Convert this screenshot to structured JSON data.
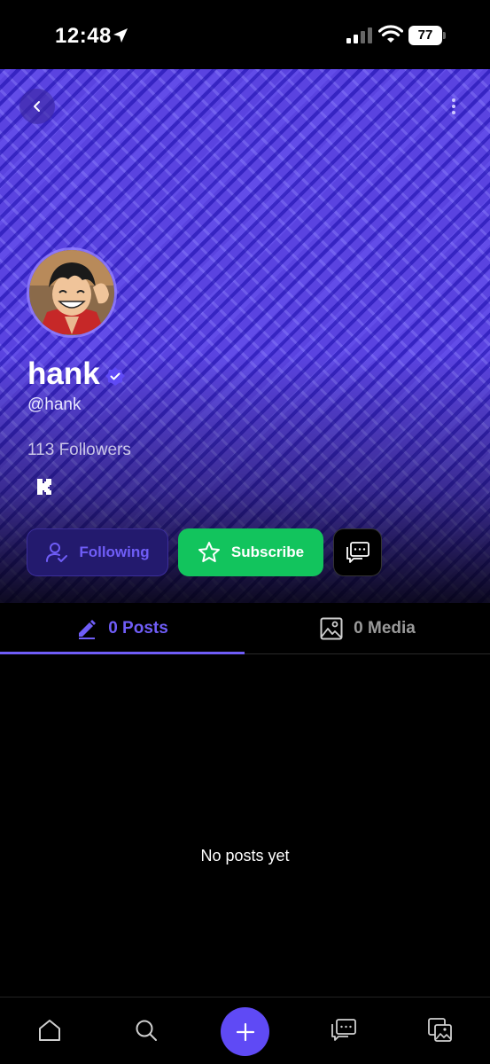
{
  "status_bar": {
    "time": "12:48",
    "battery": "77"
  },
  "profile": {
    "display_name": "hank",
    "username": "@hank",
    "followers": "113 Followers",
    "verified": true,
    "avatar": "anime-character-avatar",
    "banner_color": "#5a43e0"
  },
  "actions": {
    "following_label": "Following",
    "subscribe_label": "Subscribe"
  },
  "tabs": [
    {
      "label": "0 Posts",
      "active": true,
      "icon": "pencil-icon"
    },
    {
      "label": "0 Media",
      "active": false,
      "icon": "image-icon"
    }
  ],
  "feed": {
    "empty_message": "No posts yet"
  },
  "bottom_nav": [
    "home-icon",
    "search-icon",
    "plus-icon",
    "messages-icon",
    "collections-icon"
  ],
  "colors": {
    "accent": "#6f5df7",
    "subscribe": "#12c45d",
    "create_button": "#5f4af5"
  }
}
